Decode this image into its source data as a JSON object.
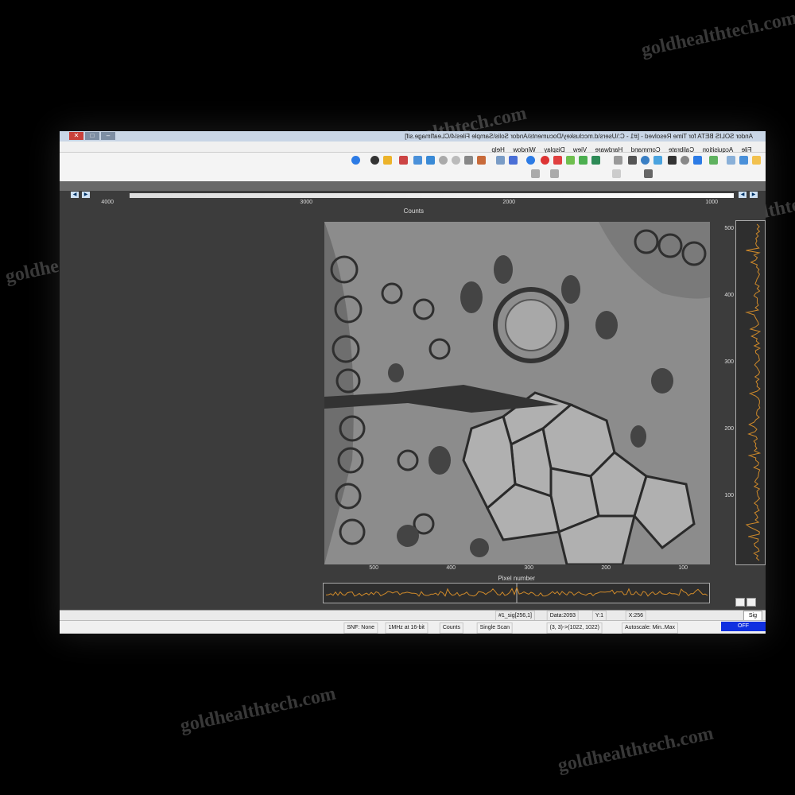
{
  "watermark": "goldhealthtech.com",
  "window": {
    "title": "Andor SOLIS BETA for Time Resolved - [#1 - C:\\Users\\d.mccluskey\\Documents\\Andor Solis\\Sample Files\\4\\CLeafImage.sif]"
  },
  "menu": [
    "File",
    "Acquisition",
    "Calibrate",
    "Command",
    "Hardware",
    "View",
    "Display",
    "Window",
    "Help"
  ],
  "plot": {
    "top_ticks": [
      "1000",
      "2000",
      "3000",
      "4000"
    ],
    "top_axis_label": "Counts",
    "y_ticks": [
      "100",
      "200",
      "300",
      "400",
      "500"
    ],
    "x_ticks": [
      "100",
      "200",
      "300",
      "400",
      "500"
    ],
    "x_axis_label": "Pixel number"
  },
  "sig_tab": "Sig",
  "info": {
    "x": "X:256",
    "y": "Y:1",
    "data": "Data:2093",
    "ref": "#1_sig[256,1]"
  },
  "status": {
    "state": "OFF",
    "autoscale": "Autoscale: Min..Max",
    "region": "(3, 3)->(1022, 1022)",
    "scan": "Single Scan",
    "mode": "Counts",
    "readout": "1MHz at 16-bit",
    "snr": "SNF: None"
  },
  "colors": {
    "trace": "#d08a2a",
    "status_off": "#1030e0"
  }
}
